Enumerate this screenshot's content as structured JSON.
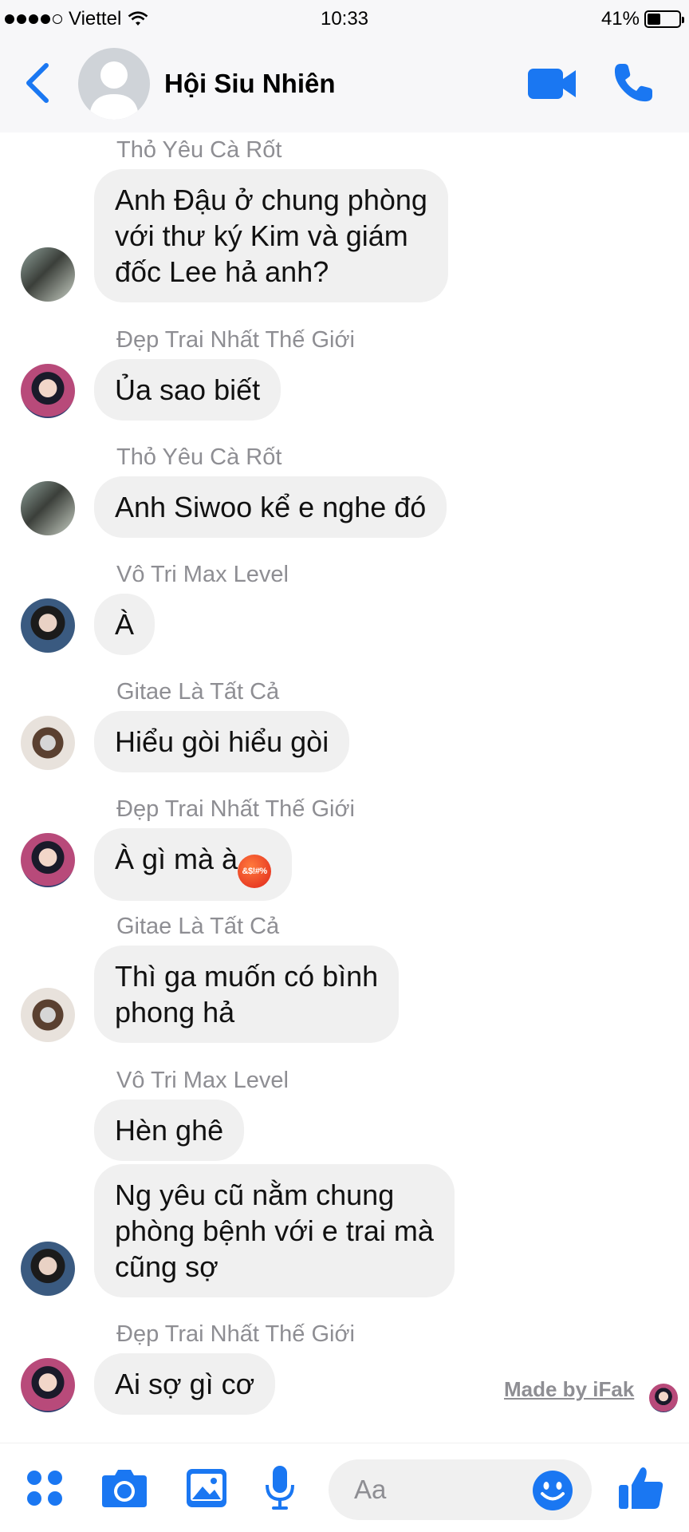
{
  "status_bar": {
    "carrier": "Viettel",
    "time": "10:33",
    "battery": "41%",
    "battery_level": 0.41
  },
  "header": {
    "title": "Hội Siu Nhiên"
  },
  "messages": [
    {
      "sender": "Thỏ Yêu Cà Rốt",
      "lines": [
        "Anh Đậu ở chung phòng",
        "với thư ký Kim và giám",
        "đốc Lee hả anh?"
      ]
    },
    {
      "sender": "Đẹp Trai Nhất Thế Giới",
      "lines": [
        "Ủa sao biết"
      ]
    },
    {
      "sender": "Thỏ Yêu Cà Rốt",
      "lines": [
        "Anh Siwoo kể e nghe đó"
      ]
    },
    {
      "sender": "Vô Tri Max Level",
      "lines": [
        "À"
      ]
    },
    {
      "sender": "Gitae Là Tất Cả",
      "lines": [
        "Hiểu gòi hiểu gòi"
      ]
    },
    {
      "sender": "Đẹp Trai Nhất Thế Giới",
      "lines": [
        "À gì mà à"
      ],
      "emoji": "angry-cursing-face"
    },
    {
      "sender": "Gitae Là Tất Cả",
      "lines": [
        "Thì ga muốn có bình",
        "phong hả"
      ]
    },
    {
      "sender": "Vô Tri Max Level",
      "lines": [
        "Hèn ghê"
      ]
    },
    {
      "lines": [
        "Ng yêu cũ nằm chung",
        "phòng bệnh với e trai mà",
        "cũng sợ"
      ]
    },
    {
      "sender": "Đẹp Trai Nhất Thế Giới",
      "lines": [
        "Ai sợ gì cơ"
      ]
    }
  ],
  "emoji_text": "&$!#%",
  "watermark": "Made by iFak",
  "composer": {
    "placeholder": "Aa",
    "icons": [
      "apps-icon",
      "camera-icon",
      "gallery-icon",
      "microphone-icon",
      "emoji-icon",
      "thumbs-up-icon"
    ]
  },
  "colors": {
    "accent": "#1a77f2",
    "bubble": "#f0f0f0",
    "sender_name": "#8e8e93",
    "header_bg": "#f7f7f9"
  }
}
